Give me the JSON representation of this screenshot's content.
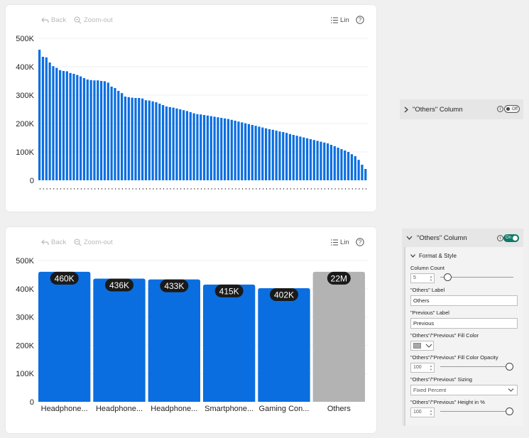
{
  "toolbar": {
    "back_label": "Back",
    "zoom_out_label": "Zoom-out",
    "scale_label": "Lin",
    "help_label": "?"
  },
  "chart_data": [
    {
      "type": "bar",
      "ylim": [
        0,
        500000
      ],
      "ytick_labels": [
        "0",
        "100K",
        "200K",
        "300K",
        "400K",
        "500K"
      ],
      "ytick_values": [
        0,
        100000,
        200000,
        300000,
        400000,
        500000
      ],
      "grid": true,
      "values": [
        460000,
        435000,
        433000,
        415000,
        402000,
        396000,
        388000,
        385000,
        384000,
        378000,
        375000,
        371000,
        366000,
        360000,
        355000,
        353000,
        352000,
        352000,
        350000,
        349000,
        344000,
        330000,
        325000,
        315000,
        307000,
        295000,
        293000,
        291000,
        290000,
        290000,
        288000,
        282000,
        281000,
        278000,
        275000,
        270000,
        265000,
        260000,
        258000,
        256000,
        253000,
        250000,
        247000,
        244000,
        240000,
        236000,
        233000,
        232000,
        230000,
        228000,
        226000,
        224000,
        222000,
        220000,
        218000,
        216000,
        213000,
        210000,
        207000,
        204000,
        201000,
        198000,
        195000,
        192000,
        189000,
        186000,
        183000,
        180000,
        178000,
        175000,
        172000,
        170000,
        167000,
        163000,
        160000,
        157000,
        154000,
        151000,
        148000,
        145000,
        142000,
        139000,
        136000,
        133000,
        130000,
        125000,
        120000,
        115000,
        110000,
        105000,
        100000,
        92000,
        85000,
        72000,
        55000,
        40000
      ]
    },
    {
      "type": "bar",
      "categories": [
        "Headphone...",
        "Headphone...",
        "Headphone...",
        "Smartphone...",
        "Gaming Con...",
        "Others"
      ],
      "values": [
        460000,
        436000,
        433000,
        415000,
        402000,
        22000000
      ],
      "data_labels": [
        "460K",
        "436K",
        "433K",
        "415K",
        "402K",
        "22M"
      ],
      "ylim": [
        0,
        500000
      ],
      "ytick_labels": [
        "0",
        "100K",
        "200K",
        "300K",
        "400K",
        "500K"
      ],
      "ytick_values": [
        0,
        100000,
        200000,
        300000,
        400000,
        500000
      ],
      "grid": true,
      "colors": {
        "bar": "#0b6ee0",
        "others": "#b3b3b3",
        "pill": "#1a1a1a"
      }
    }
  ],
  "colors": {
    "bar": "#0b6ee0",
    "others": "#b3b3b3",
    "toggle_on": "#117865"
  },
  "panel_collapsed": {
    "title": "\"Others\" Column",
    "toggle_label": "Off"
  },
  "panel_expanded": {
    "title": "\"Others\" Column",
    "toggle_label": "On",
    "section_title": "Format & Style",
    "column_count_label": "Column Count",
    "column_count_value": "5",
    "column_count_slider": 0.05,
    "others_label_label": "\"Others\" Label",
    "others_label_value": "Others",
    "previous_label_label": "\"Previous\" Label",
    "previous_label_value": "Previous",
    "fill_color_label": "\"Others\"/\"Previous\" Fill Color",
    "fill_color_value": "#a9a9a9",
    "opacity_label": "\"Others\"/\"Previous\" Fill Color Opacity",
    "opacity_value": "100",
    "opacity_slider": 1.0,
    "sizing_label": "\"Others\"/\"Previous\" Sizing",
    "sizing_value": "Fixed Percent",
    "height_label": "\"Others\"/\"Previous\" Height in %",
    "height_value": "100",
    "height_slider": 1.0
  }
}
